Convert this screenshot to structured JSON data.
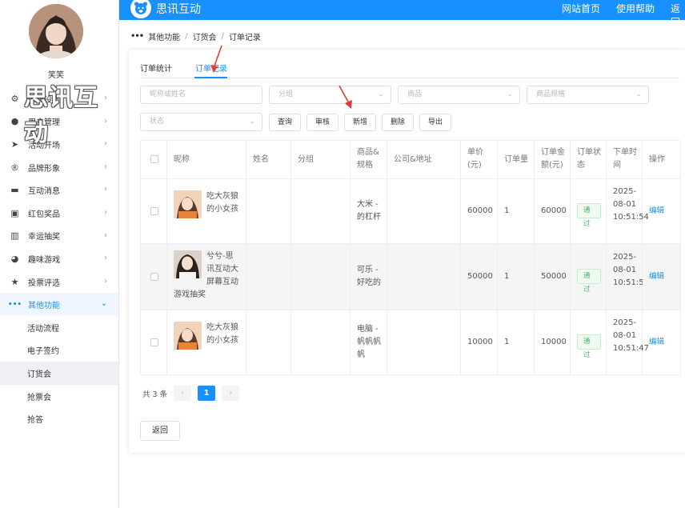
{
  "brand": {
    "name": "思讯互动",
    "watermark": "思讯互动"
  },
  "topnav": [
    "网站首页",
    "使用帮助",
    "返回"
  ],
  "user": {
    "name": "笑笑"
  },
  "sidebar": {
    "items": [
      {
        "label": "系统设置",
        "icon": "gear-icon",
        "glyph": "⚙"
      },
      {
        "label": "用户管理",
        "icon": "user-icon",
        "glyph": "●"
      },
      {
        "label": "活动开场",
        "icon": "send-icon",
        "glyph": "➤"
      },
      {
        "label": "品牌形象",
        "icon": "registered-icon",
        "glyph": "®"
      },
      {
        "label": "互动消息",
        "icon": "chat-icon",
        "glyph": "▬"
      },
      {
        "label": "红包奖品",
        "icon": "gift-icon",
        "glyph": "▣"
      },
      {
        "label": "幸运抽奖",
        "icon": "lottery-icon",
        "glyph": "▥"
      },
      {
        "label": "趣味游戏",
        "icon": "game-icon",
        "glyph": "◕"
      },
      {
        "label": "投票评选",
        "icon": "star-icon",
        "glyph": "★"
      },
      {
        "label": "其他功能",
        "icon": "more-icon",
        "glyph": "•••"
      }
    ],
    "subitems": [
      "活动流程",
      "电子签约",
      "订货会",
      "抢票会",
      "抢答"
    ]
  },
  "breadcrumb": [
    "其他功能",
    "订货会",
    "订单记录"
  ],
  "tabs": [
    "订单统计",
    "订单记录"
  ],
  "filters": {
    "nickname_placeholder": "昵称或姓名",
    "group_placeholder": "分组",
    "product_placeholder": "商品",
    "spec_placeholder": "商品规格",
    "status_placeholder": "状态"
  },
  "buttons": [
    "查询",
    "审核",
    "新增",
    "删除",
    "导出"
  ],
  "table": {
    "headers": [
      "昵称",
      "姓名",
      "分组",
      "商品&规格",
      "公司&地址",
      "单价(元)",
      "订单量",
      "订单金额(元)",
      "订单状态",
      "下单时间",
      "操作"
    ],
    "rows": [
      {
        "nickname": "吃大灰狼的小女孩",
        "name": "",
        "group": "",
        "product": "大米 - 的杠杆",
        "company": "",
        "price": "60000",
        "qty": "1",
        "amount": "60000",
        "status": "通过",
        "time": "2025-08-01 10:51:54",
        "action": "编辑"
      },
      {
        "nickname": "兮兮-思讯互动大屏幕互动游戏抽奖",
        "name": "",
        "group": "",
        "product": "可乐 - 好吃的",
        "company": "",
        "price": "50000",
        "qty": "1",
        "amount": "50000",
        "status": "通过",
        "time": "2025-08-01 10:51:50",
        "action": "编辑"
      },
      {
        "nickname": "吃大灰狼的小女孩",
        "name": "",
        "group": "",
        "product": "电脑 - 帆帆帆帆",
        "company": "",
        "price": "10000",
        "qty": "1",
        "amount": "10000",
        "status": "通过",
        "time": "2025-08-01 10:51:47",
        "action": "编辑"
      }
    ]
  },
  "pager": {
    "total": "共 3 条",
    "current": "1",
    "prev": "‹",
    "next": "›"
  },
  "back_label": "返回",
  "colors": {
    "primary": "#1890ff",
    "annotation_arrow": "#e53935",
    "status_green": "#4caf6a"
  }
}
